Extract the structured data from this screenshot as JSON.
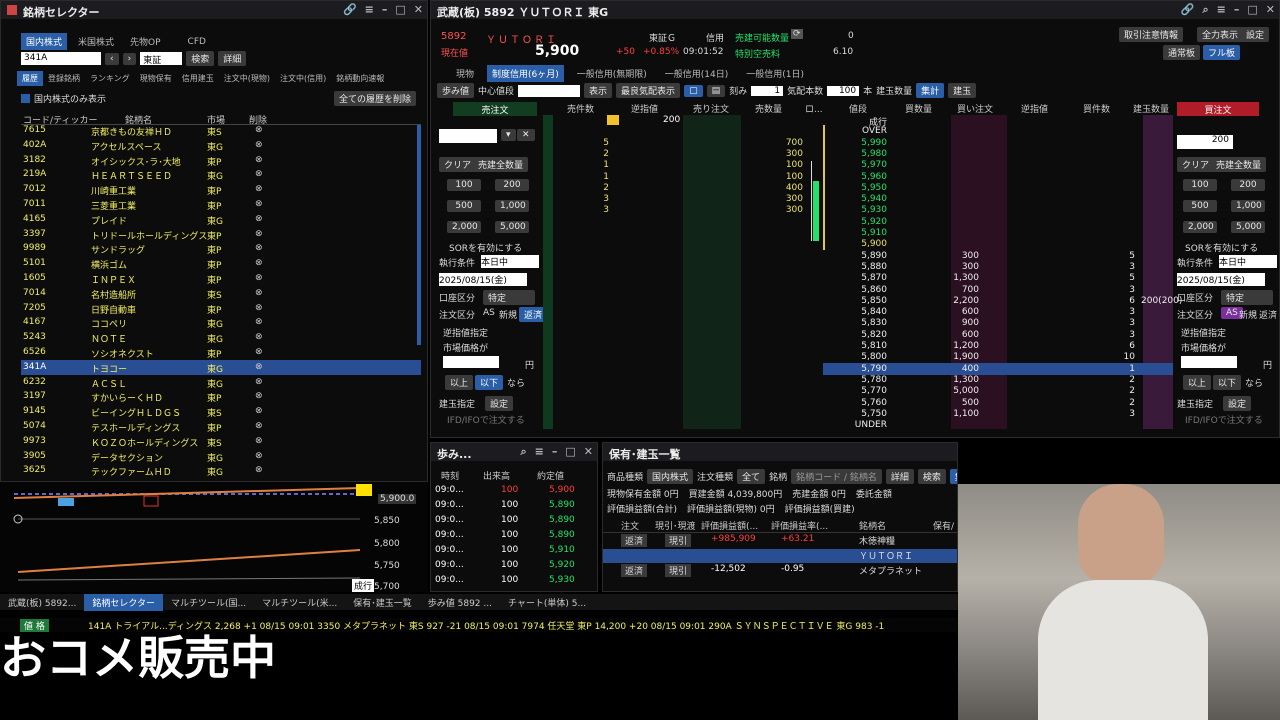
{
  "selector": {
    "title": "銘柄セレクター",
    "market_tabs": [
      "国内株式",
      "米国株式",
      "先物OP",
      "CFD"
    ],
    "search_value": "341A",
    "exchange": "東証",
    "search_btn": "検索",
    "detail_btn": "詳細",
    "subtabs": [
      "履歴",
      "登録銘柄",
      "ランキング",
      "現物保有",
      "信用建玉",
      "注文中(現物)",
      "注文中(信用)",
      "銘柄動向速報"
    ],
    "domestic_only": "国内株式のみ表示",
    "delete_all": "全ての履歴を削除",
    "headers": [
      "コード/ティッカー",
      "銘柄名",
      "市場",
      "削除"
    ],
    "rows": [
      [
        "7615",
        "京都きもの友禅ＨＤ",
        "東S"
      ],
      [
        "402A",
        "アクセルスペース",
        "東G"
      ],
      [
        "3182",
        "オイシックス･ラ･大地",
        "東P"
      ],
      [
        "219A",
        "ＨＥＡＲＴＳＥＥＤ",
        "東G"
      ],
      [
        "7012",
        "川崎重工業",
        "東P"
      ],
      [
        "7011",
        "三菱重工業",
        "東P"
      ],
      [
        "4165",
        "プレイド",
        "東G"
      ],
      [
        "3397",
        "トリドールホールディングス",
        "東P"
      ],
      [
        "9989",
        "サンドラッグ",
        "東P"
      ],
      [
        "5101",
        "横浜ゴム",
        "東P"
      ],
      [
        "1605",
        "ＩＮＰＥＸ",
        "東P"
      ],
      [
        "7014",
        "名村造船所",
        "東S"
      ],
      [
        "7205",
        "日野自動車",
        "東P"
      ],
      [
        "4167",
        "ココペリ",
        "東G"
      ],
      [
        "5243",
        "ＮＯＴＥ",
        "東G"
      ],
      [
        "6526",
        "ソシオネクスト",
        "東P"
      ],
      [
        "341A",
        "トヨコー",
        "東G"
      ],
      [
        "6232",
        "ＡＣＳＬ",
        "東G"
      ],
      [
        "3197",
        "すかいらーくＨＤ",
        "東P"
      ],
      [
        "9145",
        "ビーイングＨＬＤＧＳ",
        "東S"
      ],
      [
        "5074",
        "テスホールディングス",
        "東P"
      ],
      [
        "9973",
        "ＫＯＺＯホールディングス",
        "東S"
      ],
      [
        "3905",
        "データセクション",
        "東G"
      ],
      [
        "3625",
        "テックファームＨＤ",
        "東G"
      ]
    ],
    "selected_index": 16
  },
  "chart_small": {
    "price_labels": [
      "5,900.0",
      "5,850",
      "5,800",
      "5,750",
      "5,700"
    ],
    "tag": "成行"
  },
  "board": {
    "title": "武蔵(板) 5892 ＹＵＴＯＲＩ 東G",
    "code": "5892",
    "name": "ＹＵＴＯＲＩ",
    "market": "東証Ｇ",
    "credit": "信用",
    "label_price": "現在値",
    "price": "5,900",
    "change": "+50",
    "change_pct": "+0.85%",
    "time": "09:01:52",
    "sellable_label": "売建可能数量",
    "sellable": "0",
    "special_label": "特別空売料",
    "special": "6.10",
    "top_buttons": [
      "取引注意情報",
      "全力表示",
      "設定",
      "通常板",
      "フル板"
    ],
    "tabs": [
      "現物",
      "制度信用(6ヶ月)",
      "一般信用(無期限)",
      "一般信用(14日)",
      "一般信用(1日)"
    ],
    "toolbar": {
      "step": "歩み値",
      "center": "中心値段",
      "show": "表示",
      "best_show": "最良気配表示",
      "tick": "刻み",
      "tick_val": "1",
      "quote_count": "気配本数",
      "quote_val": "100",
      "unit": "本",
      "pos_count": "建玉数量",
      "total": "集計",
      "pos": "建玉"
    },
    "sell_order": "売注文",
    "buy_order": "買注文",
    "col_headers": [
      "売件数",
      "逆指値",
      "売り注文",
      "売数量",
      "ロ...",
      "値段",
      "買数量",
      "買い注文",
      "逆指値",
      "買件数",
      "建玉数量"
    ],
    "qty_top": "200",
    "rows": [
      {
        "sk": "",
        "sq": "",
        "p": "成行",
        "bq": "",
        "bk": ""
      },
      {
        "sk": "",
        "sq": "",
        "p": "OVER",
        "bq": "",
        "bk": ""
      },
      {
        "sk": "5",
        "sq": "700",
        "p": "5,990",
        "bq": "",
        "bk": ""
      },
      {
        "sk": "2",
        "sq": "300",
        "p": "5,980",
        "bq": "",
        "bk": ""
      },
      {
        "sk": "1",
        "sq": "100",
        "p": "5,970",
        "bq": "",
        "bk": ""
      },
      {
        "sk": "1",
        "sq": "100",
        "p": "5,960",
        "bq": "",
        "bk": ""
      },
      {
        "sk": "2",
        "sq": "400",
        "p": "5,950",
        "bq": "",
        "bk": ""
      },
      {
        "sk": "3",
        "sq": "300",
        "p": "5,940",
        "bq": "",
        "bk": ""
      },
      {
        "sk": "3",
        "sq": "300",
        "p": "5,930",
        "bq": "",
        "bk": ""
      },
      {
        "sk": "",
        "sq": "",
        "p": "5,920",
        "bq": "",
        "bk": ""
      },
      {
        "sk": "",
        "sq": "",
        "p": "5,910",
        "bq": "",
        "bk": ""
      },
      {
        "sk": "",
        "sq": "",
        "p": "5,900",
        "bq": "",
        "bk": ""
      },
      {
        "sk": "",
        "sq": "",
        "p": "5,890",
        "bq": "300",
        "bk": "5"
      },
      {
        "sk": "",
        "sq": "",
        "p": "5,880",
        "bq": "300",
        "bk": "3"
      },
      {
        "sk": "",
        "sq": "",
        "p": "5,870",
        "bq": "1,300",
        "bk": "5"
      },
      {
        "sk": "",
        "sq": "",
        "p": "5,860",
        "bq": "700",
        "bk": "3"
      },
      {
        "sk": "",
        "sq": "",
        "p": "5,850",
        "bq": "2,200",
        "bk": "6"
      },
      {
        "sk": "",
        "sq": "",
        "p": "5,840",
        "bq": "600",
        "bk": "3"
      },
      {
        "sk": "",
        "sq": "",
        "p": "5,830",
        "bq": "900",
        "bk": "3"
      },
      {
        "sk": "",
        "sq": "",
        "p": "5,820",
        "bq": "600",
        "bk": "3"
      },
      {
        "sk": "",
        "sq": "",
        "p": "5,810",
        "bq": "1,200",
        "bk": "6"
      },
      {
        "sk": "",
        "sq": "",
        "p": "5,800",
        "bq": "1,900",
        "bk": "10"
      },
      {
        "sk": "",
        "sq": "",
        "p": "5,790",
        "bq": "400",
        "bk": "1"
      },
      {
        "sk": "",
        "sq": "",
        "p": "5,780",
        "bq": "1,300",
        "bk": "2"
      },
      {
        "sk": "",
        "sq": "",
        "p": "5,770",
        "bq": "5,000",
        "bk": "2"
      },
      {
        "sk": "",
        "sq": "",
        "p": "5,760",
        "bq": "500",
        "bk": "2"
      },
      {
        "sk": "",
        "sq": "",
        "p": "5,750",
        "bq": "1,100",
        "bk": "3"
      },
      {
        "sk": "",
        "sq": "",
        "p": "UNDER",
        "bq": "",
        "bk": ""
      }
    ],
    "pos_qty": "200(200)",
    "left_panel": {
      "clear": "クリア",
      "all_sell": "売建全数量",
      "sor": "SORを有効にする",
      "cond_label": "執行条件",
      "cond": "本日中",
      "date": "2025/08/15(金)",
      "acct_label": "口座区分",
      "acct": "特定",
      "order_label": "注文区分",
      "as": "AS",
      "new": "新規",
      "repay": "返済",
      "stop_label": "逆指値指定",
      "mkt_cond": "市場価格が",
      "yen": "円",
      "above": "以上",
      "below": "以下",
      "then": "なら",
      "pos_label": "建玉指定",
      "setting": "設定",
      "ifd": "IFD/IFOで注文する",
      "qtys": [
        "100",
        "200",
        "500",
        "1,000",
        "2,000",
        "5,000"
      ]
    },
    "right_panel": {
      "qty": "200",
      "clear": "クリア",
      "all_buy": "売建全数量"
    }
  },
  "ticks": {
    "title": "歩み...",
    "headers": [
      "時刻",
      "出来高",
      "約定値"
    ],
    "rows": [
      [
        "09:0...",
        "100",
        "5,900"
      ],
      [
        "09:0...",
        "100",
        "5,890"
      ],
      [
        "09:0...",
        "100",
        "5,890"
      ],
      [
        "09:0...",
        "100",
        "5,890"
      ],
      [
        "09:0...",
        "100",
        "5,910"
      ],
      [
        "09:0...",
        "100",
        "5,920"
      ],
      [
        "09:0...",
        "100",
        "5,930"
      ]
    ]
  },
  "holdings": {
    "title": "保有･建玉一覧",
    "prod_label": "商品種類",
    "prod": "国内株式",
    "order_label": "注文種類",
    "order": "全て",
    "stock_label": "銘柄",
    "stock_ph": "銘柄コード / 銘柄名",
    "detail": "詳細",
    "search": "検索",
    "agg": "集計表示",
    "pos": "建玉表示",
    "sum1": "現物保有金額  0円",
    "sum2": "買建金額 4,039,800円",
    "sum3": "売建金額  0円",
    "sum4": "委託金額",
    "pl1": "評価損益額(合計)",
    "pl2": "評価損益額(現物) 0円",
    "pl3": "評価損益額(買建)",
    "headers": [
      "注文",
      "現引･現渡",
      "評価損益額(...",
      "評価損益率(...",
      "銘柄名",
      "保有/"
    ],
    "rows": [
      [
        "返済",
        "現引",
        "+985,909",
        "+63.21",
        "木徳神糧"
      ],
      [
        "",
        "",
        "",
        "",
        "ＹＵＴＯＲＩ"
      ],
      [
        "返済",
        "現引",
        "-12,502",
        "-0.95",
        "メタプラネット"
      ]
    ]
  },
  "taskbar": [
    "武蔵(板) 5892...",
    "銘柄セレクター",
    "マルチツール(国...",
    "マルチツール(米...",
    "保有･建玉一覧",
    "歩み値 5892 ...",
    "チャート(単体) 5..."
  ],
  "ticker": {
    "badge": "値 格",
    "text": "141A トライアル...ディングス 2,268 +1 08/15 09:01   3350 メタプラネット 東S 927 -21 08/15 09:01   7974 任天堂 東P 14,200 +20 08/15 09:01   290A ＳＹＮＳＰＥＣＴＩＶＥ 東G 983 -1"
  },
  "overlay_text": "おコメ販売中",
  "colors": {
    "accent": "#2a5fa8",
    "sell": "#d0142c",
    "buy": "#d0142c",
    "yellow_text": "#f2ef5f",
    "green": "#23e26a"
  }
}
